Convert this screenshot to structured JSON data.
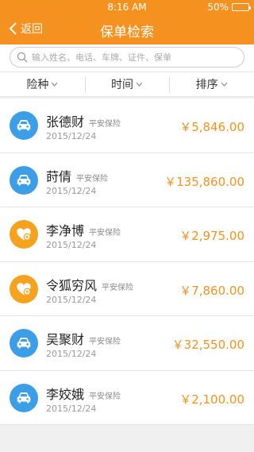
{
  "status": {
    "time": "8:16 AM",
    "battery": "50%",
    "battery_level": 0.5
  },
  "nav": {
    "back_label": "返回",
    "title": "保单检索"
  },
  "search": {
    "placeholder": "输入姓名、电话、车牌、证件、保单"
  },
  "filters": [
    {
      "label": "险种"
    },
    {
      "label": "时间"
    },
    {
      "label": "排序"
    }
  ],
  "policies": [
    {
      "name": "张德财",
      "company": "平安保险",
      "date": "2015/12/24",
      "amount": "￥5,846.00",
      "icon": "car-icon"
    },
    {
      "name": "莳倩",
      "company": "平安保险",
      "date": "2015/12/24",
      "amount": "￥135,860.00",
      "icon": "car-icon"
    },
    {
      "name": "李净博",
      "company": "平安保险",
      "date": "2015/12/24",
      "amount": "￥2,975.00",
      "icon": "heart-plus-icon"
    },
    {
      "name": "令狐穷风",
      "company": "平安保险",
      "date": "2015/12/24",
      "amount": "￥7,860.00",
      "icon": "heart-plus-icon"
    },
    {
      "name": "吴聚财",
      "company": "平安保险",
      "date": "2015/12/24",
      "amount": "￥32,550.00",
      "icon": "car-icon"
    },
    {
      "name": "李姣娥",
      "company": "平安保险",
      "date": "2015/12/24",
      "amount": "￥2,100.00",
      "icon": "car-icon"
    }
  ],
  "colors": {
    "brand": "#f5911e",
    "car_icon_bg": "#3d9ee8",
    "health_icon_bg": "#f5a21e"
  }
}
